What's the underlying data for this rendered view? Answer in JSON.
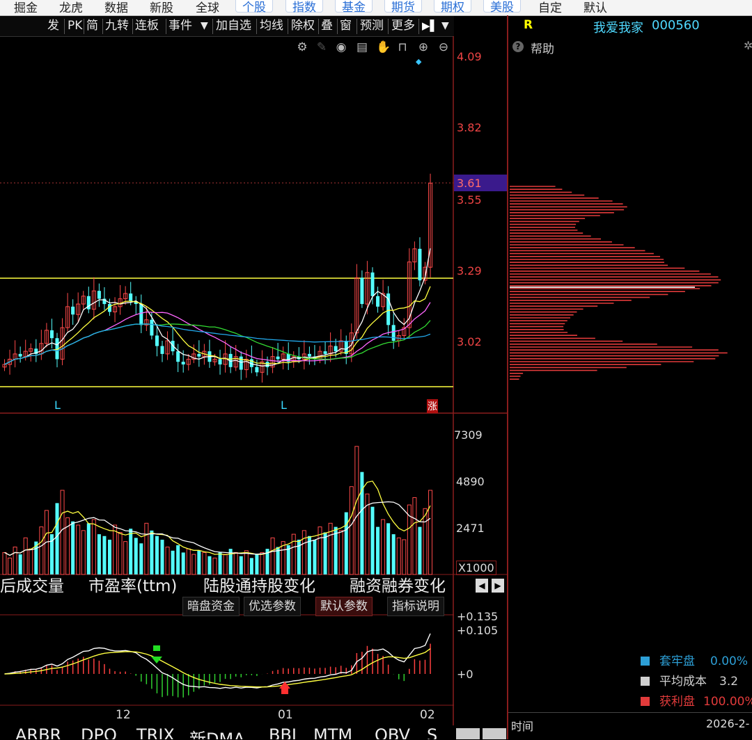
{
  "topnav": {
    "items": [
      "掘金",
      "龙虎",
      "数据",
      "新股",
      "全球",
      "个股",
      "指数",
      "基金",
      "期货",
      "期权",
      "美股",
      "自定",
      "默认"
    ],
    "selected": [
      "个股",
      "指数",
      "基金",
      "期货",
      "期权",
      "美股"
    ]
  },
  "toolbar": {
    "items": [
      "发",
      "PK",
      "简",
      "九转",
      "连板",
      "事件",
      "▼",
      "加自选",
      "均线",
      "除权",
      "叠",
      "窗",
      "预测",
      "更多"
    ],
    "arrows": [
      "▶▌",
      "▼"
    ]
  },
  "quote_header": {
    "flag": "R",
    "name": "我爱我家",
    "code": "000560"
  },
  "help_label": "帮助",
  "price_axis": {
    "ticks": [
      "4.09",
      "3.82",
      "3.55",
      "3.29",
      "3.02"
    ],
    "highlight": "3.61"
  },
  "main_markers": {
    "low1": "L",
    "low2": "L",
    "rise": "涨"
  },
  "volume_axis": {
    "ticks": [
      "7309",
      "4890",
      "2471"
    ],
    "unit": "X1000"
  },
  "indicator_tabs": [
    "后成交量",
    "市盈率(ttm)",
    "陆股通持股变化",
    "融资融券变化"
  ],
  "indicator_buttons": [
    {
      "label": "暗盘资金"
    },
    {
      "label": "优选参数"
    },
    {
      "label": "默认参数"
    },
    {
      "label": "指标说明"
    }
  ],
  "macd_axis": {
    "ticks": [
      "+0.135",
      "+0.105",
      "+0"
    ]
  },
  "date_ticks": [
    "12",
    "01",
    "02"
  ],
  "bottom_tabs": [
    "ARBR",
    "DPO",
    "TRIX",
    "新DMA",
    "BBI",
    "MTM",
    "OBV",
    "S"
  ],
  "chip_legend": [
    {
      "label": "套牢盘",
      "value": "0.00%",
      "color": "#2d9fd6"
    },
    {
      "label": "平均成本",
      "value": "3.2",
      "color": "#d0d0d0"
    },
    {
      "label": "获利盘",
      "value": "100.00%",
      "color": "#e23b3b"
    }
  ],
  "chip_footer": {
    "time_label": "时间",
    "date": "2026-2-"
  },
  "colors": {
    "up": "#ff4a4a",
    "down": "#54ffff",
    "ma5": "#ffffff",
    "ma10": "#ffff40",
    "ma20": "#ff66ff",
    "ma30": "#33dd33",
    "ma60": "#22aaee",
    "support": "#ffff40"
  }
}
